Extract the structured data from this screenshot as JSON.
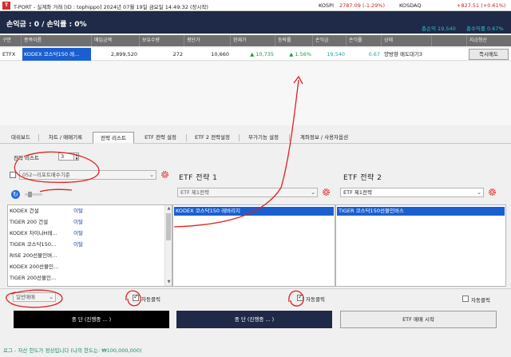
{
  "titlebar": {
    "logo": "T",
    "title": "T-PORT - 실계좌 거래 [ID : tophippo] 2024년 07월 19일 금요일 14:49:32 (장시작)",
    "kospi_label": "KOSPI",
    "kospi_value": "2787.09 (-1.29%)",
    "kosdaq_label": "KOSDAQ",
    "kosdaq_value": "+827.51 (+0.61%)"
  },
  "summary": {
    "text": "손익금 : 0 / 손익률 : 0%",
    "buy_total": "총손익 19,540",
    "profit_rate": "총수익률 0.67%"
  },
  "grid": {
    "headers": [
      "구분",
      "종목이름",
      "매입금액",
      "보유수량",
      "평단가",
      "현재가",
      "등락률",
      "손익금",
      "손익률",
      "상태",
      "",
      "지금청산"
    ],
    "row": {
      "type": "ETFX",
      "name": "KODEX 코스닥150 레...",
      "buy_amount": "2,899,520",
      "qty": "272",
      "avg_price": "10,660",
      "current": "▲ 10,735",
      "change": "▲ 1.56%",
      "pnl": "19,540",
      "pnl_rate": "0.67",
      "status": "양방향 매도대기3",
      "sell_button": "즉시매도"
    }
  },
  "tabs": [
    "대쉬보드",
    "차트 / 매매기록",
    "전략 리스트",
    "ETF 전략 설정",
    "ETF 2 전략설정",
    "부가기능 설정",
    "계좌정보 / 사용자옵션"
  ],
  "panel": {
    "strategy_count_label": "전략 리스트",
    "strategy_count_value": "3",
    "left_combo": "052~리포트매수기준",
    "etf1_title": "ETF 전략 1",
    "etf1_combo": "ETF 제1전략",
    "etf2_title": "ETF 전략 2",
    "etf2_combo": "ETF 제1전략",
    "list_items": [
      {
        "name": "KODEX 건설",
        "tag": "이탈"
      },
      {
        "name": "TIGER 200 건설",
        "tag": "이탈"
      },
      {
        "name": "KODEX 차이나H레...",
        "tag": "이탈"
      },
      {
        "name": "TIGER 코스닥150...",
        "tag": "이탈"
      },
      {
        "name": "RISE 200선물인버...",
        "tag": ""
      },
      {
        "name": "KODEX 200선물인...",
        "tag": ""
      },
      {
        "name": "TIGER 200선물인...",
        "tag": ""
      }
    ],
    "etf1_selected": "KODEX 코스닥150 레버리지",
    "etf2_selected": "TIGER 코스닥150선물인버스",
    "mode_combo": "일반매매",
    "auto_click_1": "자동클릭",
    "auto_click_2": "자동클릭",
    "auto_click_3": "자동클릭",
    "btn_stop_1": "중 단 (진행중 ... )",
    "btn_stop_2": "중 단 (진행중 ... )",
    "btn_etf_start": "ETF 매매 시작"
  },
  "status_text": "로그 - 자산 한도가 정상입니다 (나의 한도는: ₩100,000,000)",
  "colors": {
    "summary_bg": "#1e2a47",
    "selection": "#1a5fd0",
    "up": "#1a9a4a",
    "down": "#d02020",
    "annotation": "#e02020"
  }
}
